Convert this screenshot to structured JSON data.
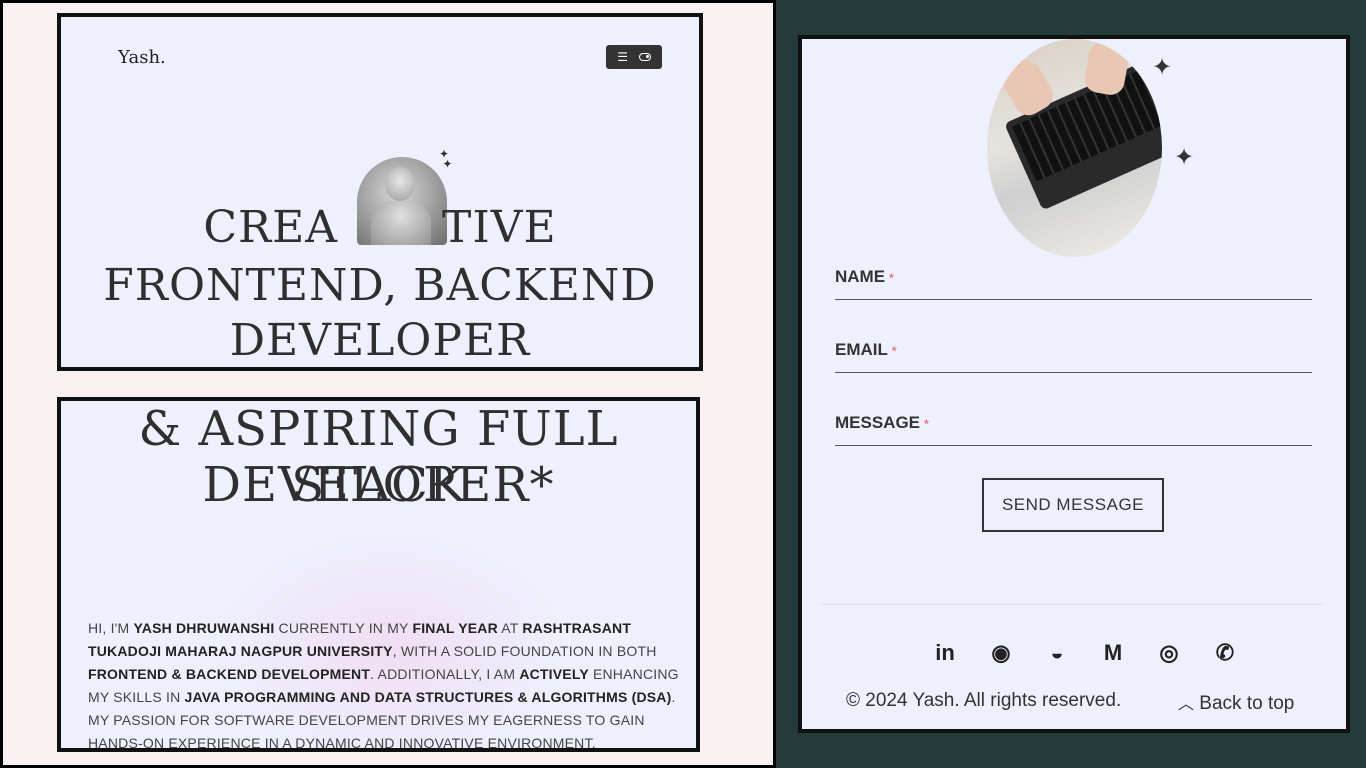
{
  "nav": {
    "logo": "Yash.",
    "menu_icon": "menu-icon",
    "theme_icon": "theme-toggle-icon"
  },
  "hero": {
    "line1_left": "CREA",
    "line1_right": "TIVE",
    "line2": "FRONTEND, BACKEND",
    "line3": "DEVELOPER",
    "line4": "& ASPIRING FULL STACK",
    "line5": "DEVELOPER*"
  },
  "bio": {
    "parts": [
      {
        "t": "Hi, I'm ",
        "b": false
      },
      {
        "t": "Yash Dhruwanshi",
        "b": true
      },
      {
        "t": " currently in my ",
        "b": false
      },
      {
        "t": "final year",
        "b": true
      },
      {
        "t": " at ",
        "b": false
      },
      {
        "t": "Rashtrasant Tukadoji Maharaj Nagpur University",
        "b": true
      },
      {
        "t": ", with a solid foundation in both ",
        "b": false
      },
      {
        "t": "Frontend & Backend Development",
        "b": true
      },
      {
        "t": ". Additionally, I am ",
        "b": false
      },
      {
        "t": "actively",
        "b": true
      },
      {
        "t": " enhancing my skills in ",
        "b": false
      },
      {
        "t": "Java Programming and Data Structures & Algorithms (DSA)",
        "b": true
      },
      {
        "t": ". My passion for software development drives my eagerness to gain hands-on experience in a dynamic and innovative environment.",
        "b": false
      }
    ]
  },
  "contact": {
    "name_label": "NAME",
    "email_label": "EMAIL",
    "message_label": "MESSAGE",
    "required_mark": "*",
    "send_label": "SEND MESSAGE"
  },
  "socials": [
    {
      "icon": "linkedin-icon",
      "glyph": "in"
    },
    {
      "icon": "github-icon",
      "glyph": "◉"
    },
    {
      "icon": "codechef-icon",
      "glyph": "◒"
    },
    {
      "icon": "gmail-icon",
      "glyph": "M"
    },
    {
      "icon": "instagram-icon",
      "glyph": "◎"
    },
    {
      "icon": "whatsapp-icon",
      "glyph": "✆"
    }
  ],
  "footer": {
    "copyright": "© 2024 Yash. All rights reserved.",
    "back_to_top": "Back to top",
    "back_icon": "^"
  }
}
